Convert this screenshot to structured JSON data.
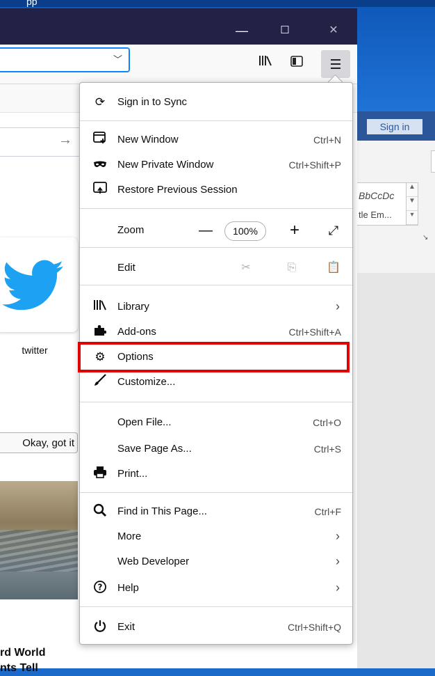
{
  "desktop": {
    "partial_text": "pp"
  },
  "window_controls": {
    "minimize": "—",
    "maximize": "☐",
    "close": "✕"
  },
  "word": {
    "sign_in": "Sign in",
    "style_sample_1": "BbCcDc",
    "style_sample_2": "tle Em..."
  },
  "page": {
    "tile_label": "twitter",
    "okay_button": "Okay, got it",
    "headline_line1": "rd World",
    "headline_line2": "nts Tell"
  },
  "menu": {
    "sync": "Sign in to Sync",
    "new_window": {
      "label": "New Window",
      "shortcut": "Ctrl+N"
    },
    "new_private_window": {
      "label": "New Private Window",
      "shortcut": "Ctrl+Shift+P"
    },
    "restore_session": "Restore Previous Session",
    "zoom": {
      "label": "Zoom",
      "minus": "—",
      "value": "100%",
      "plus": "+"
    },
    "edit": "Edit",
    "library": "Library",
    "addons": {
      "label": "Add-ons",
      "shortcut": "Ctrl+Shift+A"
    },
    "options": "Options",
    "customize": "Customize...",
    "open_file": {
      "label": "Open File...",
      "shortcut": "Ctrl+O"
    },
    "save_page": {
      "label": "Save Page As...",
      "shortcut": "Ctrl+S"
    },
    "print": "Print...",
    "find": {
      "label": "Find in This Page...",
      "shortcut": "Ctrl+F"
    },
    "more": "More",
    "web_developer": "Web Developer",
    "help": "Help",
    "exit": {
      "label": "Exit",
      "shortcut": "Ctrl+Shift+Q"
    },
    "arrow": "›"
  },
  "colors": {
    "titlebar": "#232146",
    "highlight": "#e00000",
    "twitter": "#1da1f2",
    "word_ribbon": "#2b579a"
  }
}
